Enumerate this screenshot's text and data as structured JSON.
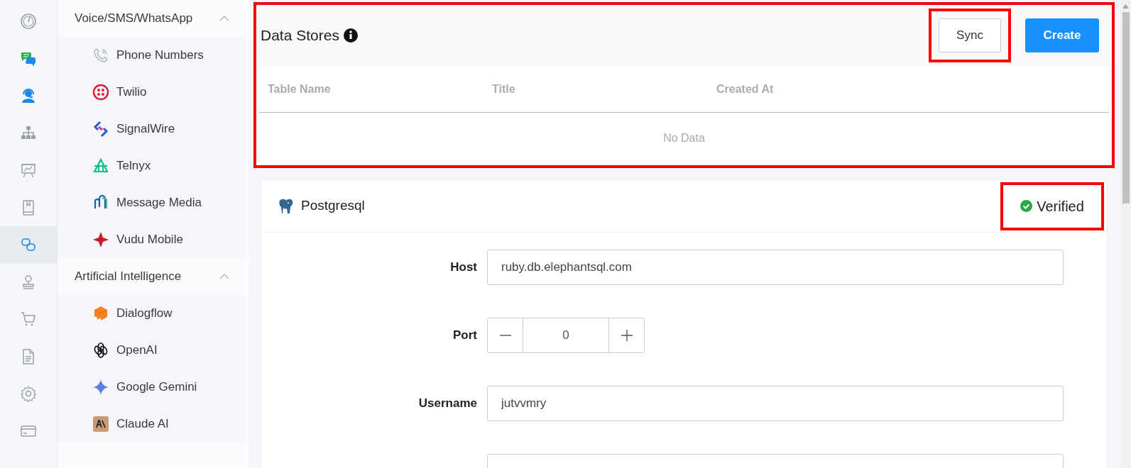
{
  "icon_rail": [
    {
      "selected": false
    },
    {
      "selected": false
    },
    {
      "selected": false
    },
    {
      "selected": false
    },
    {
      "selected": false
    },
    {
      "selected": false
    },
    {
      "selected": true
    },
    {
      "selected": false
    },
    {
      "selected": false
    },
    {
      "selected": false
    },
    {
      "selected": false
    },
    {
      "selected": false
    }
  ],
  "sidebar": {
    "groups": [
      {
        "title": "Voice/SMS/WhatsApp",
        "expanded": true,
        "items": [
          {
            "label": "Phone Numbers"
          },
          {
            "label": "Twilio"
          },
          {
            "label": "SignalWire"
          },
          {
            "label": "Telnyx"
          },
          {
            "label": "Message Media"
          },
          {
            "label": "Vudu Mobile"
          }
        ]
      },
      {
        "title": "Artificial Intelligence",
        "expanded": true,
        "items": [
          {
            "label": "Dialogflow"
          },
          {
            "label": "OpenAI"
          },
          {
            "label": "Google Gemini"
          },
          {
            "label": "Claude AI"
          }
        ]
      }
    ]
  },
  "data_stores": {
    "title": "Data Stores",
    "highlighted": true,
    "buttons": [
      {
        "label": "Sync",
        "kind": "default",
        "highlighted": true
      },
      {
        "label": "Create",
        "kind": "primary",
        "highlighted": false
      }
    ],
    "table": {
      "columns": [
        "Table Name",
        "Title",
        "Created At"
      ],
      "empty_text": "No Data"
    }
  },
  "postgres_card": {
    "title": "Postgresql",
    "status": {
      "label": "Verified",
      "highlighted": true
    },
    "fields": [
      {
        "label": "Host",
        "value": "ruby.db.elephantsql.com",
        "kind": "text"
      },
      {
        "label": "Port",
        "value": "0",
        "kind": "number"
      },
      {
        "label": "Username",
        "value": "jutvvmry",
        "kind": "text"
      },
      {
        "kind": "text"
      }
    ]
  }
}
